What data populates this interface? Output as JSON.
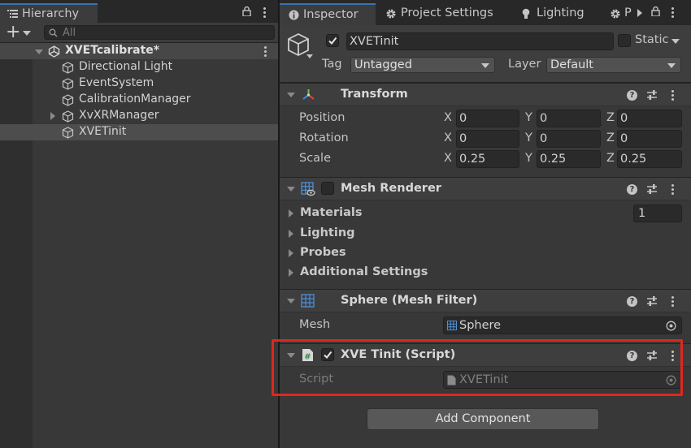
{
  "hierarchy": {
    "tab_label": "Hierarchy",
    "add_button": "+",
    "search_placeholder": "All",
    "scene_name": "XVETcalibrate*",
    "items": [
      {
        "label": "Directional Light"
      },
      {
        "label": "EventSystem"
      },
      {
        "label": "CalibrationManager"
      },
      {
        "label": "XvXRManager"
      },
      {
        "label": "XVETinit"
      }
    ]
  },
  "inspector": {
    "tabs": [
      {
        "label": "Inspector"
      },
      {
        "label": "Project Settings"
      },
      {
        "label": "Lighting"
      },
      {
        "label": "P"
      }
    ],
    "object": {
      "name": "XVETinit",
      "active": true,
      "static_label": "Static",
      "tag_label": "Tag",
      "tag_value": "Untagged",
      "layer_label": "Layer",
      "layer_value": "Default"
    },
    "transform": {
      "title": "Transform",
      "rows": [
        {
          "label": "Position",
          "x": "0",
          "y": "0",
          "z": "0"
        },
        {
          "label": "Rotation",
          "x": "0",
          "y": "0",
          "z": "0"
        },
        {
          "label": "Scale",
          "x": "0.25",
          "y": "0.25",
          "z": "0.25"
        }
      ],
      "axes": [
        "X",
        "Y",
        "Z"
      ]
    },
    "mesh_renderer": {
      "title": "Mesh Renderer",
      "materials_label": "Materials",
      "materials_count": "1",
      "foldouts": [
        "Lighting",
        "Probes",
        "Additional Settings"
      ]
    },
    "mesh_filter": {
      "title": "Sphere (Mesh Filter)",
      "mesh_label": "Mesh",
      "mesh_value": "Sphere"
    },
    "script_component": {
      "title": "XVE Tinit (Script)",
      "script_label": "Script",
      "script_value": "XVETinit"
    },
    "add_component_label": "Add Component"
  },
  "colors": {
    "highlight": "#e0271c",
    "tab_accent": "#3a72b0",
    "selection": "#4d4d4d"
  }
}
